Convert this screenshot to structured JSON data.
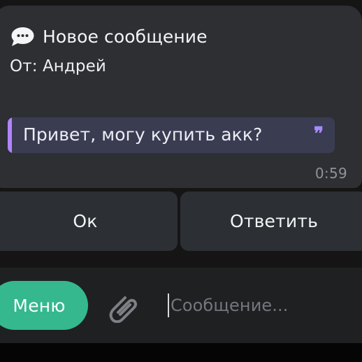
{
  "notification": {
    "title": "Новое сообщение",
    "from": "От: Андрей",
    "quote": "Привет, могу купить акк?",
    "quote_mark": "❞",
    "time": "0:59"
  },
  "buttons": {
    "ok": "Ок",
    "reply": "Ответить"
  },
  "composer": {
    "menu": "Меню",
    "placeholder": "Сообщение..."
  },
  "icons": {
    "message": "chat-bubble-icon",
    "attachment": "paperclip-icon"
  },
  "colors": {
    "accent": "#35b88e",
    "quote_bar": "#b184ff",
    "bubble": "#2d2f33"
  }
}
